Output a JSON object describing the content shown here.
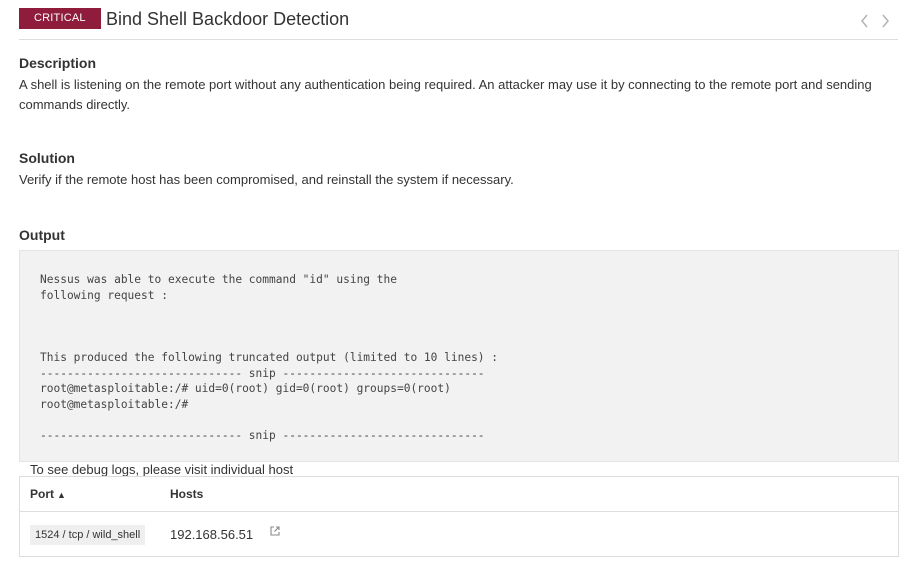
{
  "header": {
    "severity": "CRITICAL",
    "title": "Bind Shell Backdoor Detection",
    "severity_color": "#8f1c3b"
  },
  "description": {
    "heading": "Description",
    "text": "A shell is listening on the remote port without any authentication being required. An attacker may use it by connecting to the remote port and sending commands directly."
  },
  "solution": {
    "heading": "Solution",
    "text": "Verify if the remote host has been compromised, and reinstall the system if necessary."
  },
  "output": {
    "heading": "Output",
    "text": "Nessus was able to execute the command \"id\" using the\nfollowing request :\n\n\n\nThis produced the following truncated output (limited to 10 lines) :\n------------------------------ snip ------------------------------\nroot@metasploitable:/# uid=0(root) gid=0(root) groups=0(root)\nroot@metasploitable:/#\n\n------------------------------ snip ------------------------------"
  },
  "debug_note": "To see debug logs, please visit individual host",
  "table": {
    "columns": {
      "port": "Port",
      "port_sort": "▲",
      "hosts": "Hosts"
    },
    "rows": [
      {
        "port": "1524 / tcp / wild_shell",
        "host": "192.168.56.51"
      }
    ]
  },
  "icons": {
    "prev": "chevron-left-icon",
    "next": "chevron-right-icon",
    "link": "external-link-icon"
  }
}
